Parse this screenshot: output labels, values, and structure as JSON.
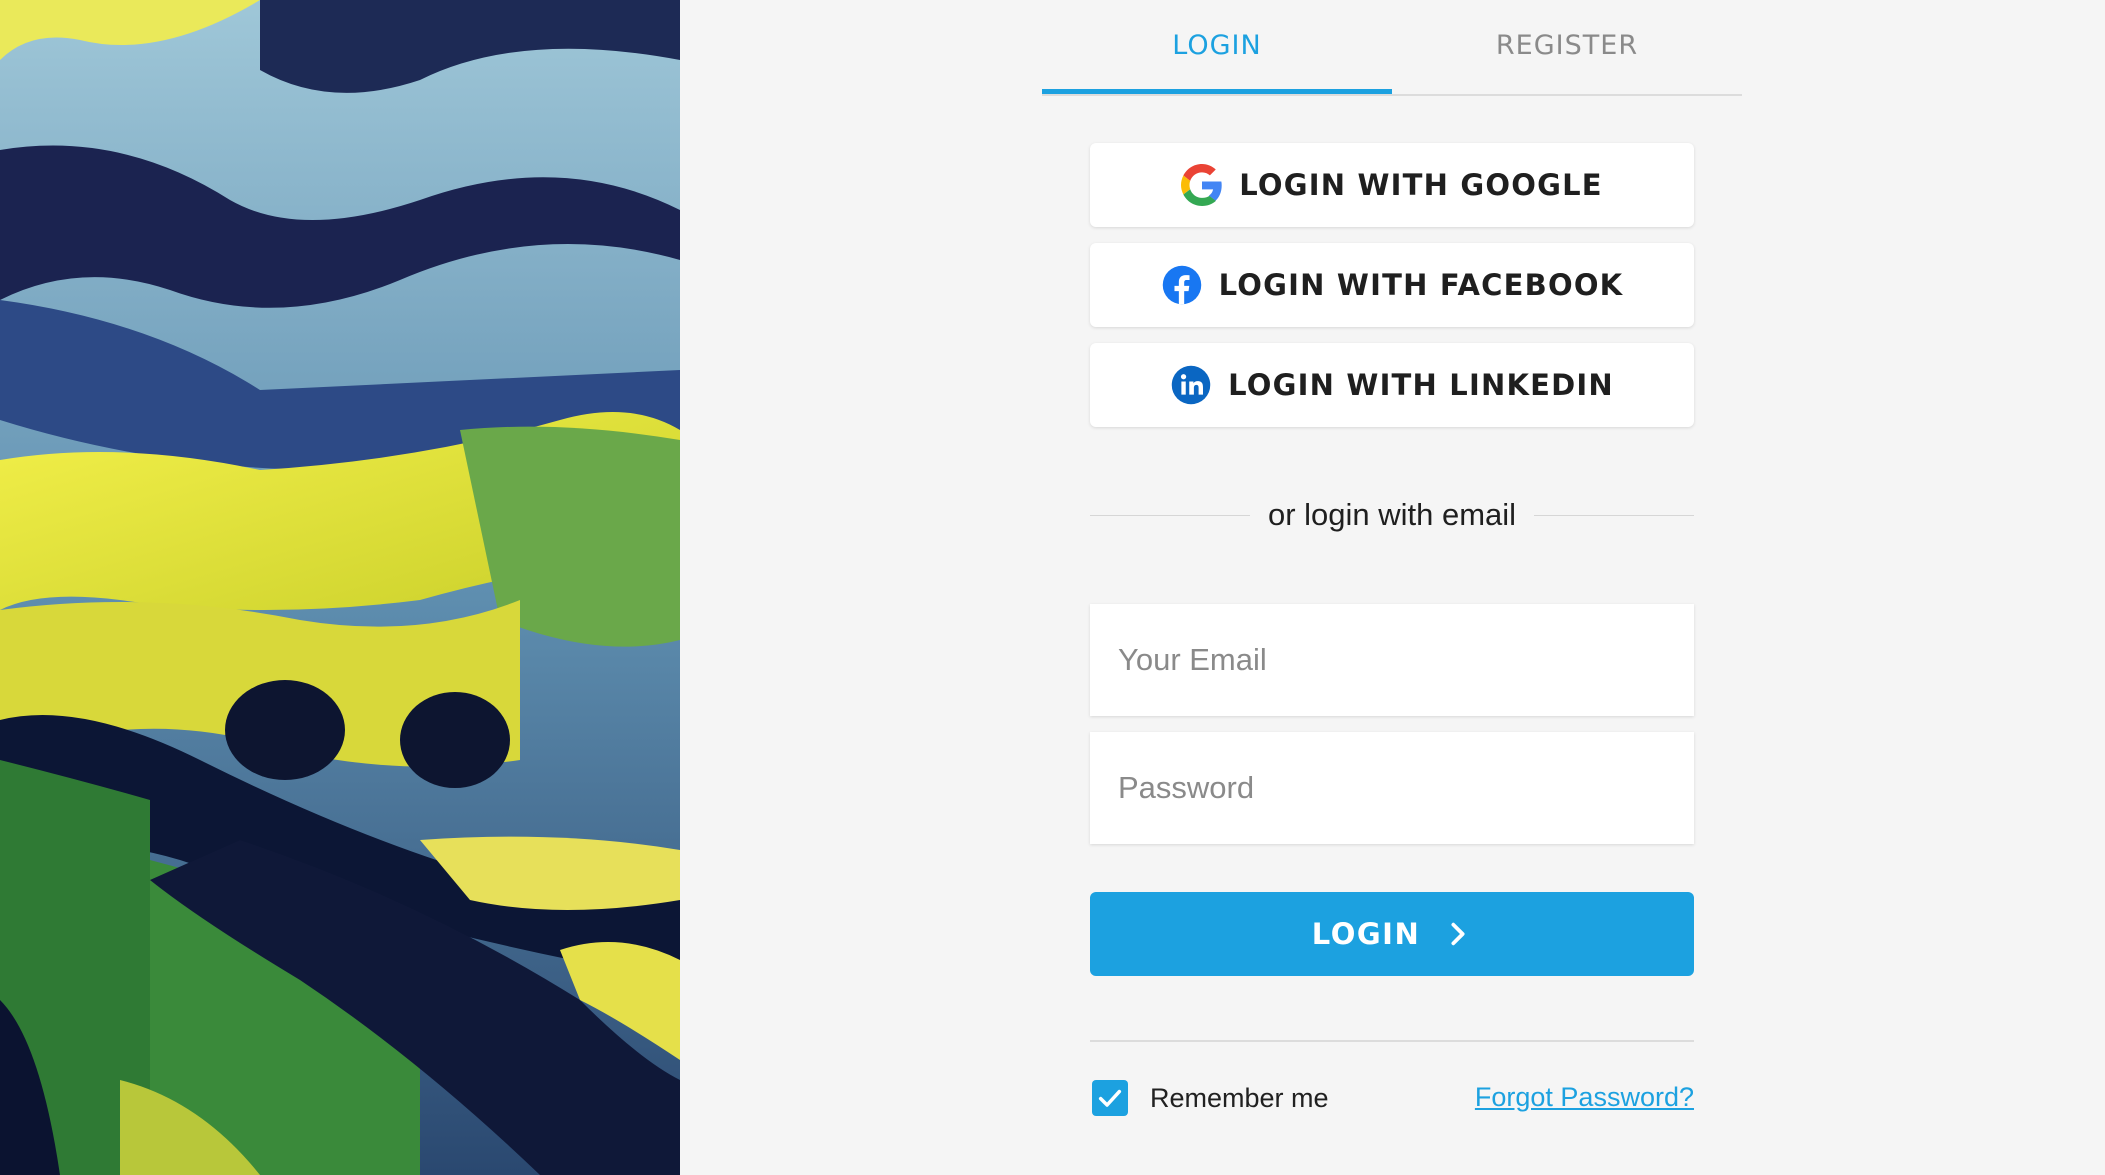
{
  "tabs": [
    {
      "label": "LOGIN",
      "active": true
    },
    {
      "label": "REGISTER",
      "active": false
    }
  ],
  "social": {
    "google": {
      "label": "LOGIN WITH GOOGLE",
      "icon": "google-icon"
    },
    "facebook": {
      "label": "LOGIN WITH FACEBOOK",
      "icon": "facebook-icon"
    },
    "linkedin": {
      "label": "LOGIN WITH LINKEDIN",
      "icon": "linkedin-icon"
    }
  },
  "divider": {
    "text": "or login with email"
  },
  "form": {
    "email_placeholder": "Your Email",
    "email_value": "",
    "password_placeholder": "Password",
    "password_value": ""
  },
  "login_button": {
    "label": "LOGIN",
    "icon": "chevron-right-icon"
  },
  "remember": {
    "label": "Remember me",
    "checked": true
  },
  "forgot": {
    "label": "Forgot Password?"
  },
  "colors": {
    "accent": "#1ca1e0",
    "background": "#f5f5f5",
    "facebook": "#1877f2",
    "linkedin": "#0a66c2"
  }
}
